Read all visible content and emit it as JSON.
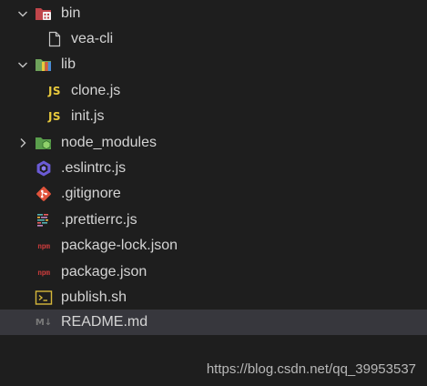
{
  "tree": {
    "items": [
      {
        "label": "bin",
        "kind": "folder",
        "expanded": true,
        "icon": "bin-folder-icon"
      },
      {
        "label": "vea-cli",
        "kind": "file",
        "icon": "file-icon"
      },
      {
        "label": "lib",
        "kind": "folder",
        "expanded": true,
        "icon": "lib-folder-icon"
      },
      {
        "label": "clone.js",
        "kind": "file",
        "icon": "js-icon",
        "badge": "JS"
      },
      {
        "label": "init.js",
        "kind": "file",
        "icon": "js-icon",
        "badge": "JS"
      },
      {
        "label": "node_modules",
        "kind": "folder",
        "expanded": false,
        "icon": "node-folder-icon"
      },
      {
        "label": ".eslintrc.js",
        "kind": "file",
        "icon": "eslint-icon"
      },
      {
        "label": ".gitignore",
        "kind": "file",
        "icon": "git-icon"
      },
      {
        "label": ".prettierrc.js",
        "kind": "file",
        "icon": "prettier-icon"
      },
      {
        "label": "package-lock.json",
        "kind": "file",
        "icon": "npm-icon",
        "badge": "npm"
      },
      {
        "label": "package.json",
        "kind": "file",
        "icon": "npm-icon",
        "badge": "npm"
      },
      {
        "label": "publish.sh",
        "kind": "file",
        "icon": "terminal-icon"
      },
      {
        "label": "README.md",
        "kind": "file",
        "icon": "markdown-icon",
        "badge": "M↓",
        "selected": true
      }
    ]
  },
  "watermark": "https://blog.csdn.net/qq_39953537",
  "colors": {
    "background": "#1e1e1e",
    "selected_row": "#37373d",
    "text": "#d4d4d4",
    "js": "#e8c93c",
    "npm": "#c03a3a",
    "git": "#e0533b",
    "eslint": "#6b5bd6",
    "node": "#5a9e4c"
  }
}
